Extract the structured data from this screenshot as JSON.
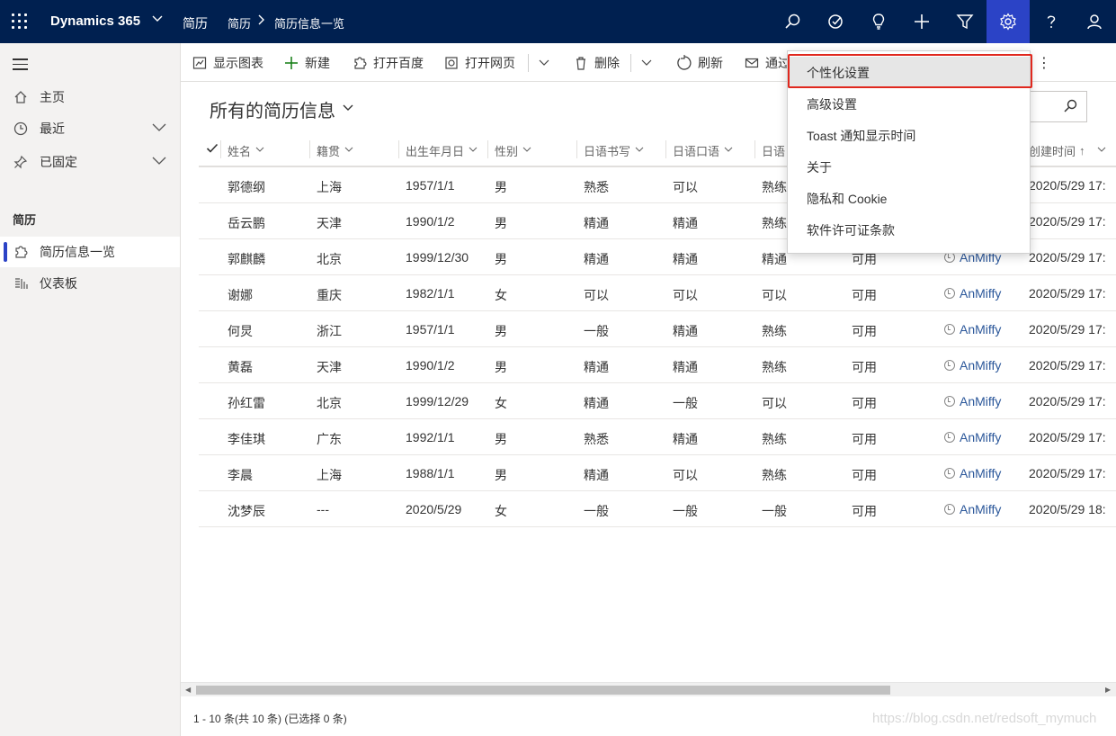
{
  "topbar": {
    "brand": "Dynamics 365",
    "app_name": "简历",
    "breadcrumb": [
      "简历",
      "简历信息一览"
    ],
    "background": "#002050",
    "active_color": "#2b43c6",
    "icons": [
      "search-icon",
      "task-icon",
      "lightbulb-icon",
      "plus-icon",
      "filter-icon",
      "settings-icon",
      "help-icon",
      "user-icon"
    ]
  },
  "leftnav": {
    "items": [
      {
        "label": "主页",
        "icon": "home-icon"
      },
      {
        "label": "最近",
        "icon": "clock-icon"
      },
      {
        "label": "已固定",
        "icon": "pin-icon"
      }
    ],
    "group_label": "简历",
    "group_items": [
      {
        "label": "简历信息一览",
        "icon": "puzzle-icon",
        "selected": true
      },
      {
        "label": "仪表板",
        "icon": "dashboard-icon"
      }
    ]
  },
  "commands": {
    "show_chart": "显示图表",
    "new": "新建",
    "open_baidu": "打开百度",
    "open_web": "打开网页",
    "delete": "删除",
    "refresh": "刷新",
    "email": "通过"
  },
  "view": {
    "title": "所有的简历信息"
  },
  "grid": {
    "columns": [
      "姓名",
      "籍贯",
      "出生年月日",
      "性别",
      "日语书写",
      "日语口语",
      "日语",
      "创建时间"
    ],
    "rows": [
      [
        "郭德纲",
        "上海",
        "1957/1/1",
        "男",
        "熟悉",
        "可以",
        "熟练",
        "",
        "",
        "2020/5/29 17:"
      ],
      [
        "岳云鹏",
        "天津",
        "1990/1/2",
        "男",
        "精通",
        "精通",
        "熟练",
        "",
        "",
        "2020/5/29 17:"
      ],
      [
        "郭麒麟",
        "北京",
        "1999/12/30",
        "男",
        "精通",
        "精通",
        "精通",
        "可用",
        "AnMiffy",
        "2020/5/29 17:"
      ],
      [
        "谢娜",
        "重庆",
        "1982/1/1",
        "女",
        "可以",
        "可以",
        "可以",
        "可用",
        "AnMiffy",
        "2020/5/29 17:"
      ],
      [
        "何炅",
        "浙江",
        "1957/1/1",
        "男",
        "一般",
        "精通",
        "熟练",
        "可用",
        "AnMiffy",
        "2020/5/29 17:"
      ],
      [
        "黄磊",
        "天津",
        "1990/1/2",
        "男",
        "精通",
        "精通",
        "熟练",
        "可用",
        "AnMiffy",
        "2020/5/29 17:"
      ],
      [
        "孙红雷",
        "北京",
        "1999/12/29",
        "女",
        "精通",
        "一般",
        "可以",
        "可用",
        "AnMiffy",
        "2020/5/29 17:"
      ],
      [
        "李佳琪",
        "广东",
        "1992/1/1",
        "男",
        "熟悉",
        "精通",
        "熟练",
        "可用",
        "AnMiffy",
        "2020/5/29 17:"
      ],
      [
        "李晨",
        "上海",
        "1988/1/1",
        "男",
        "精通",
        "可以",
        "熟练",
        "可用",
        "AnMiffy",
        "2020/5/29 17:"
      ],
      [
        "沈梦辰",
        "---",
        "2020/5/29",
        "女",
        "一般",
        "一般",
        "一般",
        "可用",
        "AnMiffy",
        "2020/5/29 18:"
      ]
    ],
    "sort_arrow": "↑"
  },
  "footer": {
    "status": "1 - 10 条(共 10 条) (已选择 0 条)",
    "watermark": "https://blog.csdn.net/redsoft_mymuch"
  },
  "settings_menu": {
    "items": [
      "个性化设置",
      "高级设置",
      "Toast 通知显示时间",
      "关于",
      "隐私和 Cookie",
      "软件许可证条款"
    ],
    "highlight_color": "#e0281e"
  }
}
